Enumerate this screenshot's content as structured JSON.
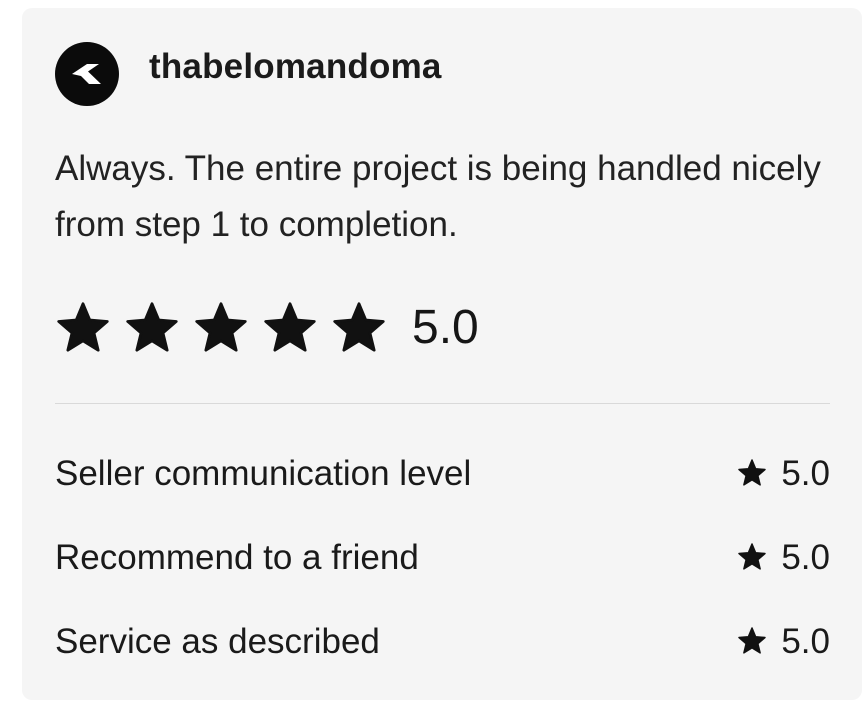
{
  "review": {
    "username": "thabelomandoma",
    "avatar_icon": "arrow-logo-icon",
    "text": "Always. The entire project is being handled nicely from step 1 to completion.",
    "overall_rating": "5.0",
    "stars_filled": 5,
    "stars_total": 5,
    "star_color": "#111111"
  },
  "breakdown": [
    {
      "label": "Seller communication level",
      "value": "5.0"
    },
    {
      "label": "Recommend to a friend",
      "value": "5.0"
    },
    {
      "label": "Service as described",
      "value": "5.0"
    }
  ],
  "colors": {
    "card_background": "#f5f5f5",
    "avatar_background": "#0b0b0b",
    "divider": "#d9d9d9",
    "text": "#1b1b1b"
  }
}
